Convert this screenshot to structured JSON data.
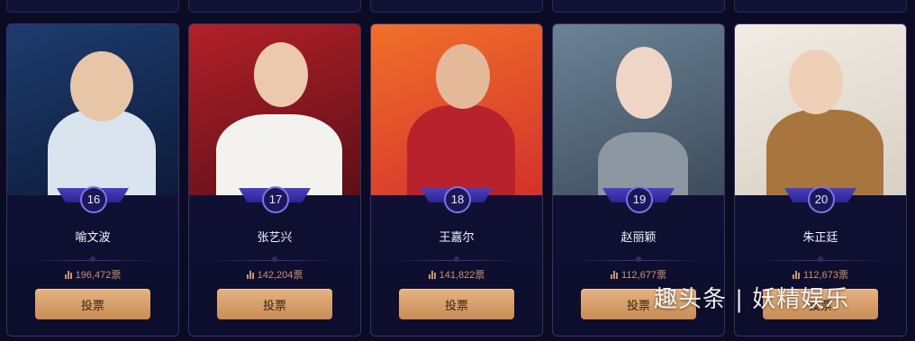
{
  "cards": [
    {
      "rank": "16",
      "name": "喻文波",
      "votes": "196,472票",
      "button": "投票",
      "photo_colors": [
        "#1d3c6e",
        "#0e1b3a"
      ],
      "accent": "#d9e4ef"
    },
    {
      "rank": "17",
      "name": "张艺兴",
      "votes": "142,204票",
      "button": "投票",
      "photo_colors": [
        "#b32028",
        "#5c0f18"
      ],
      "accent": "#f4f2ee"
    },
    {
      "rank": "18",
      "name": "王嘉尔",
      "votes": "141,822票",
      "button": "投票",
      "photo_colors": [
        "#f0702a",
        "#d4312c"
      ],
      "accent": "#b8222c"
    },
    {
      "rank": "19",
      "name": "赵丽颖",
      "votes": "112,677票",
      "button": "投票",
      "photo_colors": [
        "#6c8296",
        "#3d4c5c"
      ],
      "accent": "#8c97a2"
    },
    {
      "rank": "20",
      "name": "朱正廷",
      "votes": "112,673票",
      "button": "投票",
      "photo_colors": [
        "#f2ece4",
        "#d8d0c4"
      ],
      "accent": "#a9753f"
    }
  ],
  "watermark": "趣头条 | 妖精娱乐"
}
